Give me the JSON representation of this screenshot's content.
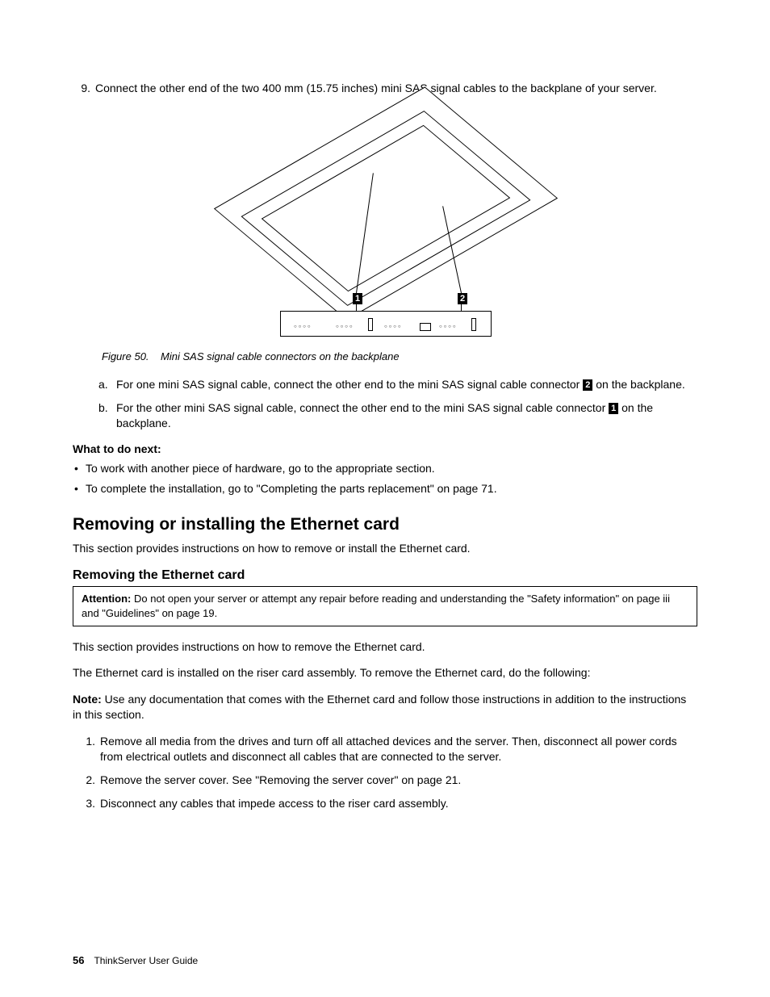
{
  "step9": {
    "number": "9.",
    "text": "Connect the other end of the two 400 mm (15.75 inches) mini SAS signal cables to the backplane of your server."
  },
  "figure": {
    "label": "Figure 50.",
    "caption": "Mini SAS signal cable connectors on the backplane",
    "callout1": "1",
    "callout2": "2"
  },
  "substeps": {
    "a_letter": "a.",
    "a_pre": "For one mini SAS signal cable, connect the other end to the mini SAS signal cable connector ",
    "a_callout": "2",
    "a_post": " on the backplane.",
    "b_letter": "b.",
    "b_pre": "For the other mini SAS signal cable, connect the other end to the mini SAS signal cable connector ",
    "b_callout": "1",
    "b_post": " on the backplane."
  },
  "what_next": {
    "heading": "What to do next:",
    "item1": "To work with another piece of hardware, go to the appropriate section.",
    "item2": "To complete the installation, go to \"Completing the parts replacement\" on page 71."
  },
  "h2": "Removing or installing the Ethernet card",
  "h2_intro": "This section provides instructions on how to remove or install the Ethernet card.",
  "h3": "Removing the Ethernet card",
  "attention": {
    "label": "Attention:",
    "text": " Do not open your server or attempt any repair before reading and understanding the \"Safety information\" on page iii and \"Guidelines\" on page 19."
  },
  "p1": "This section provides instructions on how to remove the Ethernet card.",
  "p2": "The Ethernet card is installed on the riser card assembly. To remove the Ethernet card, do the following:",
  "note": {
    "label": "Note:",
    "text": " Use any documentation that comes with the Ethernet card and follow those instructions in addition to the instructions in this section."
  },
  "steps": {
    "s1n": "1.",
    "s1": "Remove all media from the drives and turn off all attached devices and the server. Then, disconnect all power cords from electrical outlets and disconnect all cables that are connected to the server.",
    "s2n": "2.",
    "s2": "Remove the server cover. See \"Removing the server cover\" on page 21.",
    "s3n": "3.",
    "s3": "Disconnect any cables that impede access to the riser card assembly."
  },
  "footer": {
    "page": "56",
    "title": "ThinkServer User Guide"
  }
}
